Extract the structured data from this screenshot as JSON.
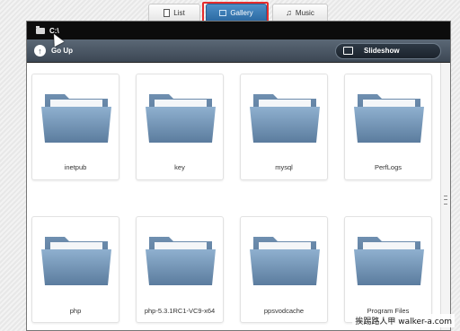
{
  "tabs": {
    "list_label": "List",
    "gallery_label": "Gallery",
    "music_label": "Music"
  },
  "pathbar": {
    "path": "C:\\"
  },
  "toolbar": {
    "go_up_label": "Go Up",
    "slideshow_label": "Slideshow"
  },
  "folders": [
    {
      "name": "inetpub"
    },
    {
      "name": "key"
    },
    {
      "name": "mysql"
    },
    {
      "name": "PerfLogs"
    },
    {
      "name": "php"
    },
    {
      "name": "php-5.3.1RC1-VC9-x64"
    },
    {
      "name": "ppsvodcache"
    },
    {
      "name": "Program Files"
    }
  ],
  "watermark": "挨踢路人甲 walker-a.com",
  "colors": {
    "accent": "#2c6aa3",
    "highlight": "#e52d2d",
    "folder": "#6f8fb0"
  }
}
